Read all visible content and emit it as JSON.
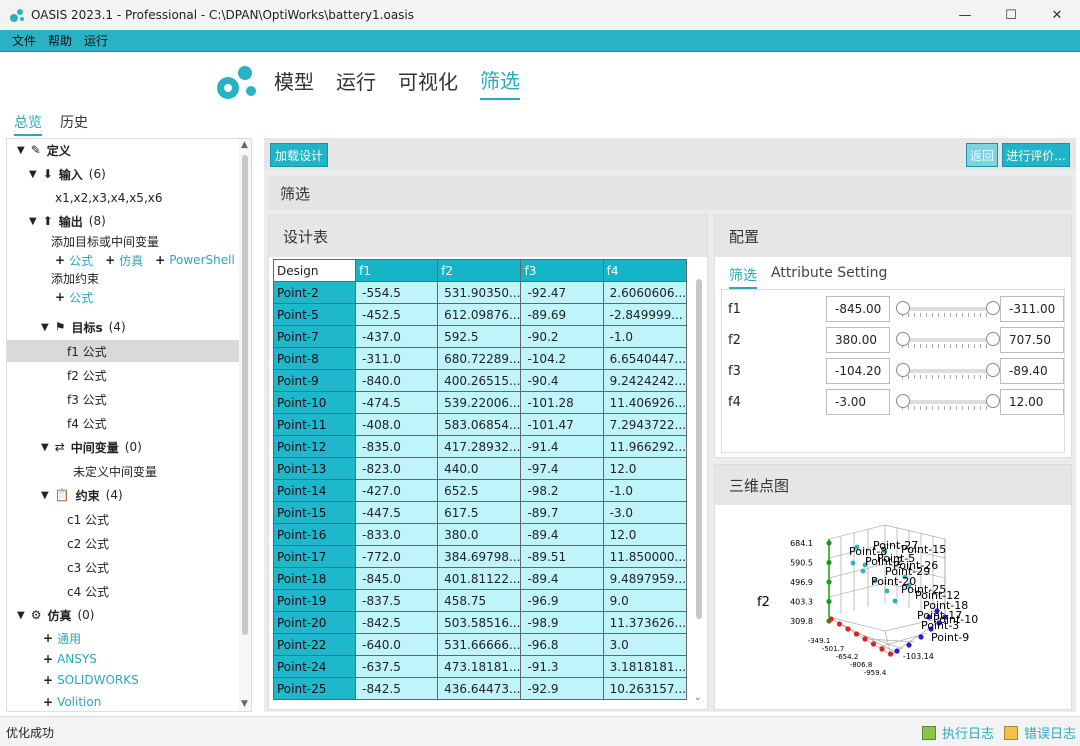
{
  "window": {
    "title": "OASIS 2023.1 - Professional - C:\\DPAN\\OptiWorks\\battery1.oasis",
    "minimize": "—",
    "maximize": "☐",
    "close": "✕"
  },
  "menu": [
    "文件",
    "帮助",
    "运行"
  ],
  "nav": {
    "tabs": [
      "模型",
      "运行",
      "可视化",
      "筛选"
    ],
    "active": "筛选"
  },
  "left_tabs": [
    "总览",
    "历史"
  ],
  "tree": {
    "define": "定义",
    "input": {
      "label": "输入",
      "count": "(6)",
      "vars": "x1,x2,x3,x4,x5,x6"
    },
    "output": {
      "label": "输出",
      "count": "(8)",
      "add_target": "添加目标或中间变量",
      "links": [
        "公式",
        "仿真",
        "PowerShell"
      ],
      "add_constraint": "添加约束",
      "constraint_link": "公式"
    },
    "targets": {
      "label": "目标s",
      "count": "(4)",
      "items": [
        "f1  公式",
        "f2  公式",
        "f3  公式",
        "f4  公式"
      ]
    },
    "intermediate": {
      "label": "中间变量",
      "count": "(0)",
      "empty": "未定义中间变量"
    },
    "constraints": {
      "label": "约束",
      "count": "(4)",
      "items": [
        "c1  公式",
        "c2  公式",
        "c3  公式",
        "c4  公式"
      ]
    },
    "simulation": {
      "label": "仿真",
      "count": "(0)",
      "items": [
        "通用",
        "ANSYS",
        "SOLIDWORKS",
        "Volition"
      ]
    }
  },
  "toolbar": {
    "load": "加载设计",
    "back": "返回",
    "evaluate": "进行评价..."
  },
  "filter_header": "筛选",
  "design_table": {
    "title": "设计表",
    "columns": [
      "Design",
      "f1",
      "f2",
      "f3",
      "f4"
    ],
    "rows": [
      [
        "Point-2",
        "-554.5",
        "531.90350...",
        "-92.47",
        "2.6060606..."
      ],
      [
        "Point-5",
        "-452.5",
        "612.09876...",
        "-89.69",
        "-2.849999..."
      ],
      [
        "Point-7",
        "-437.0",
        "592.5",
        "-90.2",
        "-1.0"
      ],
      [
        "Point-8",
        "-311.0",
        "680.72289...",
        "-104.2",
        "6.6540447..."
      ],
      [
        "Point-9",
        "-840.0",
        "400.26515...",
        "-90.4",
        "9.2424242..."
      ],
      [
        "Point-10",
        "-474.5",
        "539.22006...",
        "-101.28",
        "11.406926..."
      ],
      [
        "Point-11",
        "-408.0",
        "583.06854...",
        "-101.47",
        "7.2943722..."
      ],
      [
        "Point-12",
        "-835.0",
        "417.28932...",
        "-91.4",
        "11.966292..."
      ],
      [
        "Point-13",
        "-823.0",
        "440.0",
        "-97.4",
        "12.0"
      ],
      [
        "Point-14",
        "-427.0",
        "652.5",
        "-98.2",
        "-1.0"
      ],
      [
        "Point-15",
        "-447.5",
        "617.5",
        "-89.7",
        "-3.0"
      ],
      [
        "Point-16",
        "-833.0",
        "380.0",
        "-89.4",
        "12.0"
      ],
      [
        "Point-17",
        "-772.0",
        "384.69798...",
        "-89.51",
        "11.850000..."
      ],
      [
        "Point-18",
        "-845.0",
        "401.81122...",
        "-89.4",
        "9.4897959..."
      ],
      [
        "Point-19",
        "-837.5",
        "458.75",
        "-96.9",
        "9.0"
      ],
      [
        "Point-20",
        "-842.5",
        "503.58516...",
        "-98.9",
        "11.373626..."
      ],
      [
        "Point-22",
        "-640.0",
        "531.66666...",
        "-96.8",
        "3.0"
      ],
      [
        "Point-24",
        "-637.5",
        "473.18181...",
        "-91.3",
        "3.1818181..."
      ],
      [
        "Point-25",
        "-842.5",
        "436.64473...",
        "-92.9",
        "10.263157..."
      ]
    ]
  },
  "config": {
    "title": "配置",
    "tabs": [
      "筛选",
      "Attribute Setting"
    ],
    "active_tab": "筛选",
    "filters": [
      {
        "name": "f1",
        "min": "-845.00",
        "max": "-311.00"
      },
      {
        "name": "f2",
        "min": "380.00",
        "max": "707.50"
      },
      {
        "name": "f3",
        "min": "-104.20",
        "max": "-89.40"
      },
      {
        "name": "f4",
        "min": "-3.00",
        "max": "12.00"
      }
    ]
  },
  "scatter": {
    "title": "三维点图",
    "zlabel": "f2",
    "z_ticks": [
      "684.1",
      "590.5",
      "496.9",
      "403.3",
      "309.8"
    ],
    "x_ticks": [
      "-349.1",
      "-501.7",
      "-654.2",
      "-806.8",
      "-959.4"
    ],
    "y_ticks": [
      "-103.14"
    ],
    "point_labels": [
      "Point-27",
      "Point-15",
      "Point-8",
      "Point-5",
      "Point-2",
      "Point-26",
      "Point-29",
      "Point-20",
      "Point-25",
      "Point-12",
      "Point-18",
      "Point-10",
      "Point-17",
      "Point-3",
      "Point-9"
    ]
  },
  "status": {
    "text": "优化成功",
    "exec_log": "执行日志",
    "error_log": "错误日志"
  },
  "colors": {
    "accent": "#29b1c4",
    "table_header": "#15b5c8",
    "table_cell": "#bff4fa"
  }
}
